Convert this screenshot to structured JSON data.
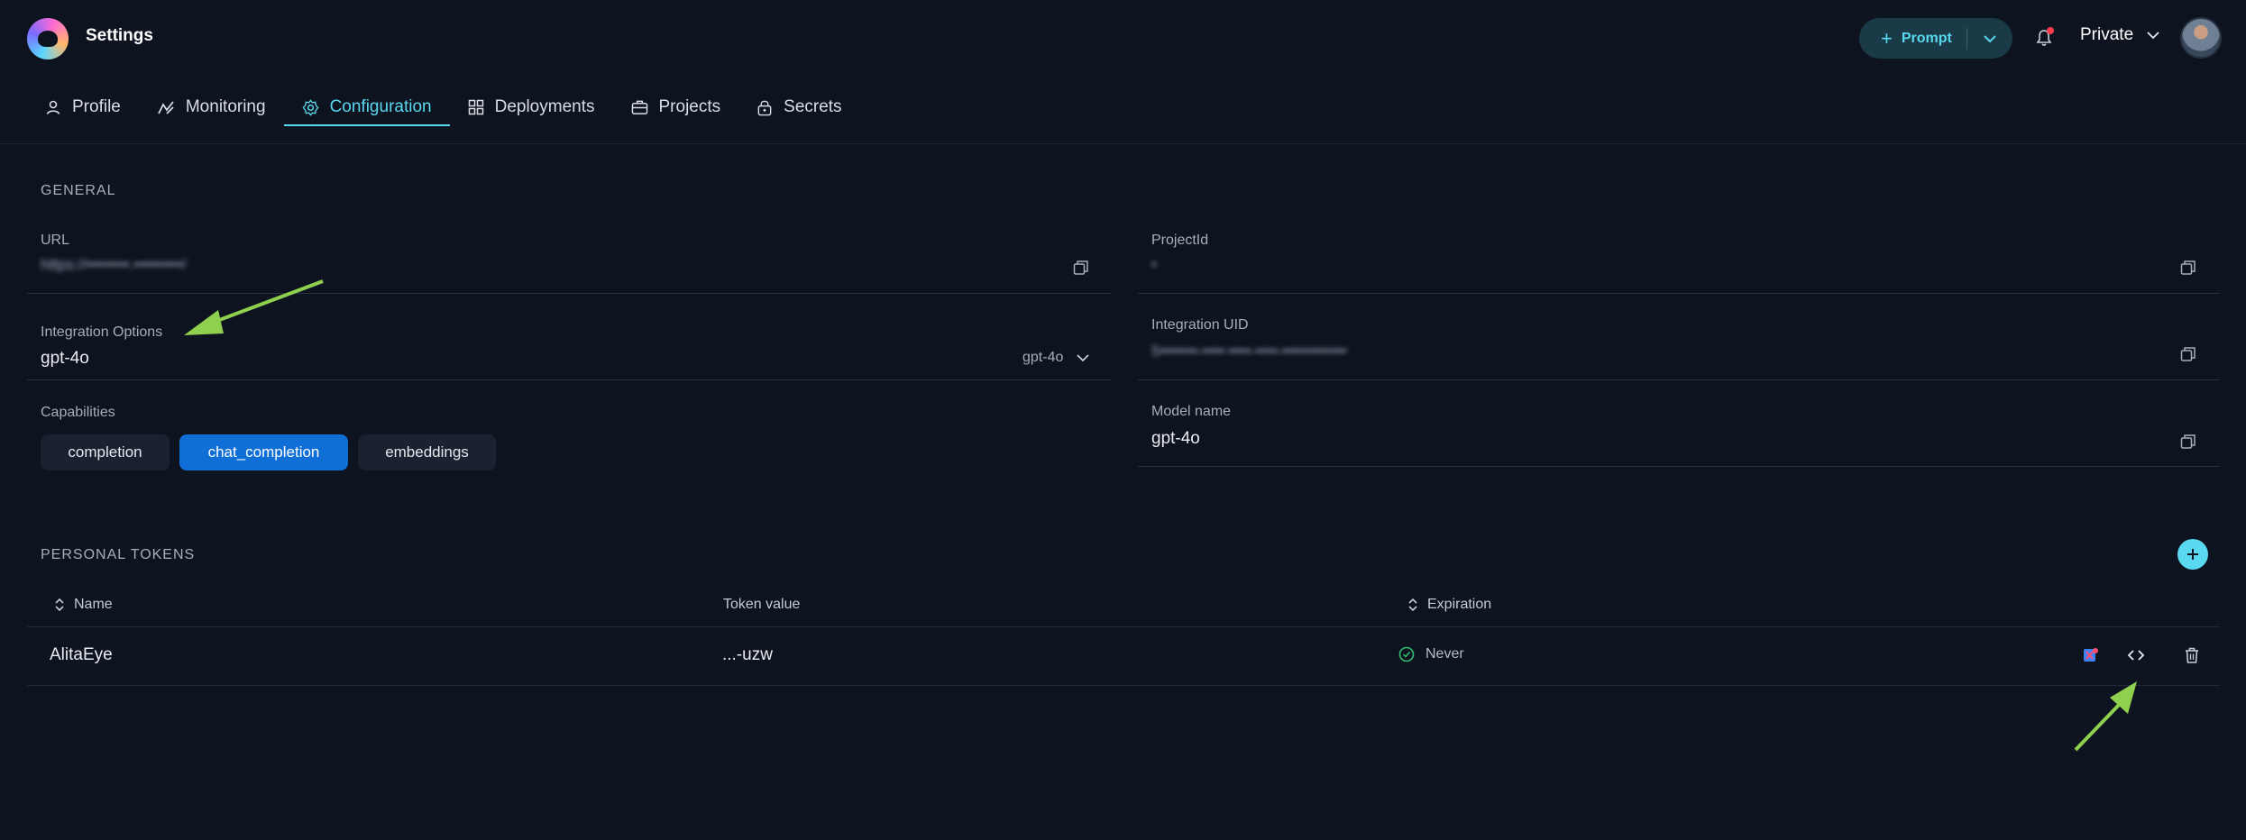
{
  "header": {
    "app_title": "Settings",
    "prompt_button": "Prompt",
    "workspace": "Private",
    "accent": "#59d9f0"
  },
  "tabs": [
    {
      "label": "Profile",
      "icon": "user-icon"
    },
    {
      "label": "Monitoring",
      "icon": "chart-icon"
    },
    {
      "label": "Configuration",
      "icon": "gear-icon",
      "active": true
    },
    {
      "label": "Deployments",
      "icon": "grid-icon"
    },
    {
      "label": "Projects",
      "icon": "briefcase-icon"
    },
    {
      "label": "Secrets",
      "icon": "lock-icon"
    }
  ],
  "general": {
    "title": "GENERAL",
    "url": {
      "label": "URL",
      "value": "https://••••••••.•••••••••/"
    },
    "project_id": {
      "label": "ProjectId",
      "value": "•"
    },
    "integration_options": {
      "label": "Integration Options",
      "value": "gpt-4o",
      "selected": "gpt-4o"
    },
    "integration_uid": {
      "label": "Integration UID",
      "value": "5•••••••-••••-••••-••••-••••••••••••"
    },
    "capabilities": {
      "label": "Capabilities",
      "items": [
        "completion",
        "chat_completion",
        "embeddings"
      ],
      "active": "chat_completion"
    },
    "model_name": {
      "label": "Model name",
      "value": "gpt-4o"
    }
  },
  "tokens": {
    "title": "PERSONAL TOKENS",
    "columns": {
      "name": "Name",
      "token": "Token value",
      "expiration": "Expiration"
    },
    "rows": [
      {
        "name": "AlitaEye",
        "token": "...-uzw",
        "expiration": "Never"
      }
    ]
  }
}
